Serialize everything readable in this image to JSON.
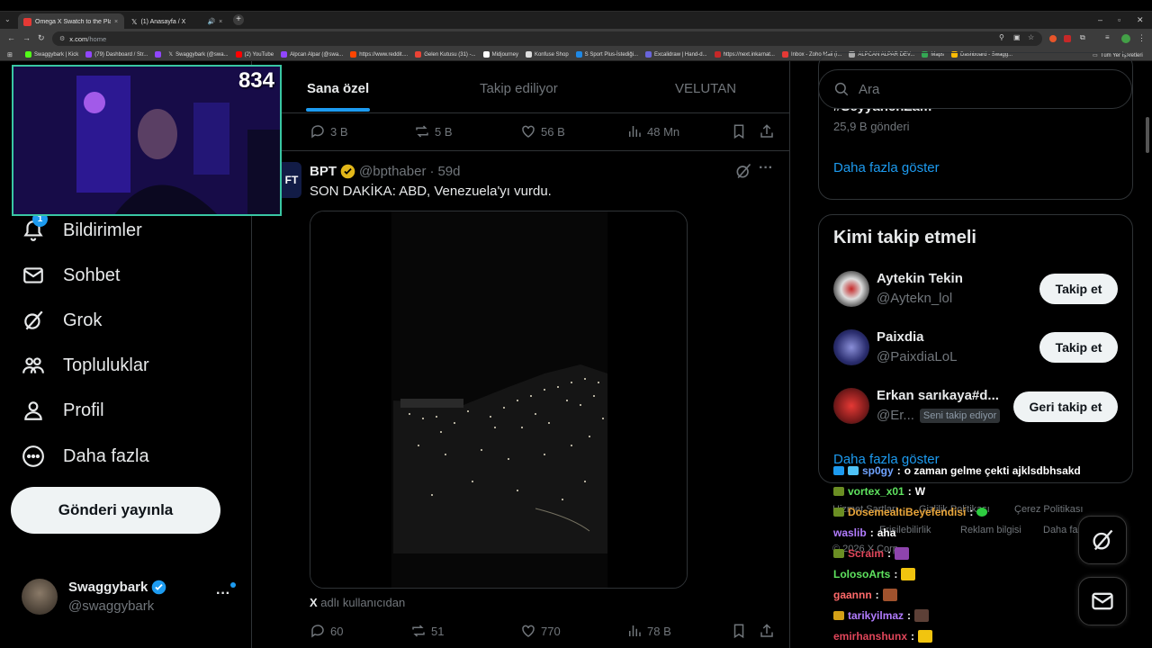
{
  "browser": {
    "tabs": [
      {
        "title": "Omega X Swatch to the Planet",
        "active": true
      },
      {
        "title": "(1) Anasayfa / X",
        "active": false
      }
    ],
    "url_host": "x.com",
    "url_path": "/home",
    "bookmarks": [
      "Swaggybark | Kick",
      "(79) Dashboard / Str...",
      "Swaggybark (@swa...",
      "(2) YouTube",
      "Alpcan Alpar (@swa...",
      "https://www.reddit....",
      "Gelen Kutusu (31) -...",
      "Midjourney",
      "Konfuse Shop",
      "S Sport Plus-İstediği...",
      "Excalidraw | Hand-d...",
      "https://next.inkarnat...",
      "Inbox - Zoho Mail (i...",
      "ALPCAN ALPAR DEV...",
      "Maps",
      "Dashboard - Swagg..."
    ],
    "all_bookmarks": "Tüm Yer İşaretleri"
  },
  "stream": {
    "viewers": "834"
  },
  "nav": {
    "notif_count": "1",
    "items": [
      {
        "label": "Bildirimler",
        "icon": "bell-icon"
      },
      {
        "label": "Sohbet",
        "icon": "mail-icon"
      },
      {
        "label": "Grok",
        "icon": "grok-icon"
      },
      {
        "label": "Topluluklar",
        "icon": "communities-icon"
      },
      {
        "label": "Profil",
        "icon": "profile-icon"
      },
      {
        "label": "Daha fazla",
        "icon": "more-circle-icon"
      }
    ],
    "post_button": "Gönderi yayınla"
  },
  "account": {
    "name": "Swaggybark",
    "handle": "@swaggybark"
  },
  "feed": {
    "tabs": [
      "Sana özel",
      "Takip ediliyor",
      "VELUTAN"
    ],
    "prev_actions": {
      "replies": "3 B",
      "reposts": "5 B",
      "likes": "56 B",
      "views": "48 Mn"
    },
    "tweet": {
      "name": "BPT",
      "handle": "@bpthaber",
      "time": "59d",
      "text": "SON DAKİKA: ABD, Venezuela'yı vurdu.",
      "source_bold": "X",
      "source_rest": "adlı kullanıcıdan",
      "actions": {
        "replies": "60",
        "reposts": "51",
        "likes": "770",
        "views": "78 B"
      }
    }
  },
  "right": {
    "search_placeholder": "Ara",
    "trend": {
      "tag": "#SeyyahenZam",
      "count": "25,9 B gönderi",
      "more": "Daha fazla göster"
    },
    "who_to_follow": {
      "title": "Kimi takip etmeli",
      "users": [
        {
          "name": "Aytekin Tekin",
          "handle": "@Aytekn_lol",
          "button": "Takip et"
        },
        {
          "name": "Paixdia",
          "handle": "@PaixdiaLoL",
          "button": "Takip et"
        },
        {
          "name": "Erkan sarıkaya#d...",
          "handle": "@Er...",
          "badge": "Seni takip ediyor",
          "button": "Geri takip et"
        }
      ],
      "more": "Daha fazla göster"
    },
    "footer": [
      "Hizmet Şartları",
      "Gizlilik Politikası",
      "Çerez Politikası",
      "Erişilebilirlik",
      "Reklam bilgisi",
      "Daha fazla",
      "© 2026 X Corp."
    ]
  },
  "chat": [
    {
      "user": "sp0gy",
      "msg": "o zaman gelme çekti ajklsdbhsakd",
      "color": "#6fa3ff"
    },
    {
      "user": "vortex_x01",
      "msg": "W",
      "color": "#5fe35f"
    },
    {
      "user": "DosemealtiBeyefendisi",
      "msg": "",
      "color": "#e8a53a"
    },
    {
      "user": "waslib",
      "msg": "aha",
      "color": "#b27cff"
    },
    {
      "user": "Scraim",
      "msg": "",
      "color": "#e0465a"
    },
    {
      "user": "LolosoArts",
      "msg": "",
      "color": "#5fe35f"
    },
    {
      "user": "gaannn",
      "msg": "",
      "color": "#ff6a6a"
    },
    {
      "user": "tarikyilmaz",
      "msg": "",
      "color": "#b27cff"
    },
    {
      "user": "emirhanshunx",
      "msg": "",
      "color": "#e0465a"
    }
  ]
}
